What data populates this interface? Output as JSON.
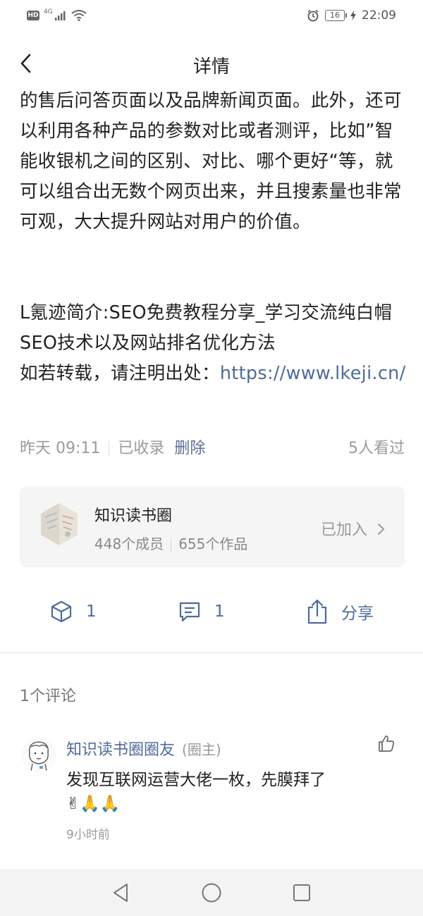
{
  "status_bar": {
    "hd": "HD",
    "network": "4G",
    "battery": "16",
    "time": "22:09"
  },
  "header": {
    "title": "详情"
  },
  "article": {
    "paragraph": "的售后问答页面以及品牌新闻页面。此外，还可以利用各种产品的参数对比或者测评，比如”智能收银机之间的区别、对比、哪个更好“等，就可以组合出无数个网页出来，并且搜素量也非常可观，大大提升网站对用户的价值。",
    "source_line": "L氪迹简介:SEO免费教程分享_学习交流纯白帽SEO技术以及网站排名优化方法",
    "repost_prefix": "如若转载，请注明出处：",
    "repost_link": "https://www.lkeji.cn/"
  },
  "meta": {
    "time": "昨天 09:11",
    "status": "已收录",
    "delete_label": "删除",
    "views": "5人看过"
  },
  "circle": {
    "name": "知识读书圈",
    "members": "448个成员",
    "works": "655个作品",
    "joined_label": "已加入"
  },
  "actions": {
    "like_count": "1",
    "comment_count": "1",
    "share_label": "分享"
  },
  "comments": {
    "count_label": "1个评论",
    "items": [
      {
        "user": "知识读书圈圈友",
        "role": "(圈主)",
        "text": "发现互联网运营大佬一枚，先膜拜了",
        "emoji": "✌🙏🙏",
        "time": "9小时前"
      }
    ]
  },
  "colors": {
    "accent": "#4f6b9a",
    "muted": "#9a9a9a",
    "card_bg": "#f5f5f5",
    "nav_bg": "#f3f3f3"
  }
}
